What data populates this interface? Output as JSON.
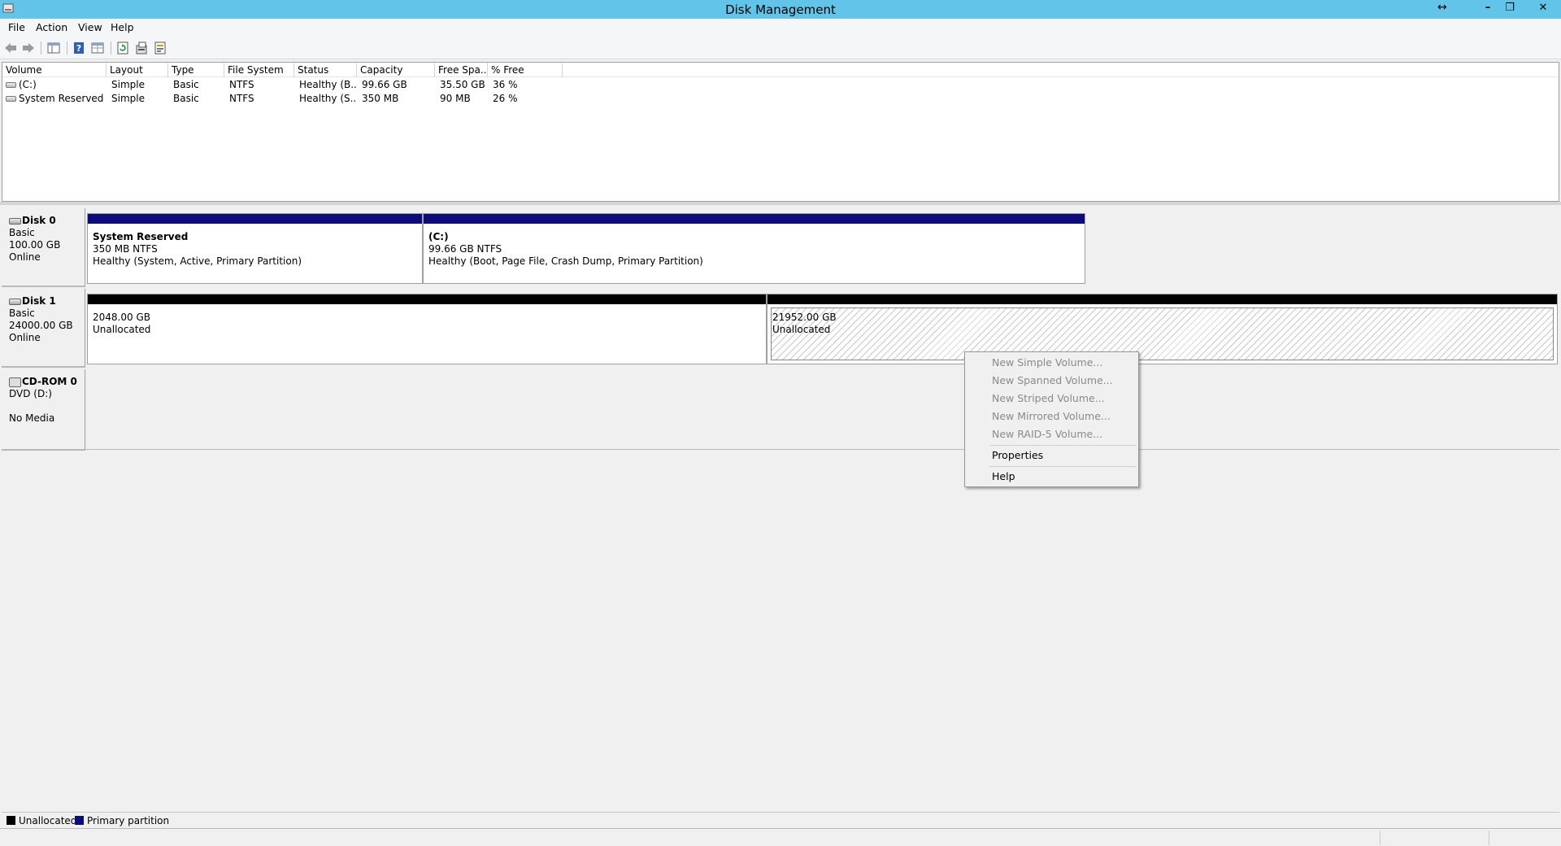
{
  "window": {
    "title": "Disk Management",
    "resize_glyph": "↔",
    "minimize": "–",
    "restore": "❐",
    "close": "✕"
  },
  "menu": [
    "File",
    "Action",
    "View",
    "Help"
  ],
  "toolbar": {
    "icons": [
      "back-arrow-icon",
      "forward-arrow-icon",
      "console-tree-icon",
      "help-icon",
      "view-icon",
      "refresh-icon",
      "properties-icon",
      "rescan-disks-icon"
    ]
  },
  "volume_list": {
    "columns": [
      "Volume",
      "Layout",
      "Type",
      "File System",
      "Status",
      "Capacity",
      "Free Spa...",
      "% Free"
    ],
    "rows": [
      [
        "(C:)",
        "Simple",
        "Basic",
        "NTFS",
        "Healthy (B...",
        "99.66 GB",
        "35.50 GB",
        "36 %"
      ],
      [
        "System Reserved",
        "Simple",
        "Basic",
        "NTFS",
        "Healthy (S...",
        "350 MB",
        "90 MB",
        "26 %"
      ]
    ]
  },
  "disks": [
    {
      "name": "Disk 0",
      "kind": "Basic",
      "size": "100.00 GB",
      "state": "Online",
      "partitions": [
        {
          "title": "System Reserved",
          "line1": "350 MB NTFS",
          "line2": "Healthy (System, Active, Primary Partition)"
        },
        {
          "title": "(C:)",
          "line1": "99.66 GB NTFS",
          "line2": "Healthy (Boot, Page File, Crash Dump, Primary Partition)"
        }
      ]
    },
    {
      "name": "Disk 1",
      "kind": "Basic",
      "size": "24000.00 GB",
      "state": "Online",
      "partitions": [
        {
          "line1": "2048.00 GB",
          "line2": "Unallocated"
        },
        {
          "line1": "21952.00 GB",
          "line2": "Unallocated"
        }
      ]
    }
  ],
  "cdrom": {
    "name": "CD-ROM 0",
    "drive": "DVD (D:)",
    "media": "No Media"
  },
  "context_menu": {
    "items": [
      "New Simple Volume...",
      "New Spanned Volume...",
      "New Striped Volume...",
      "New Mirrored Volume...",
      "New RAID-5 Volume...",
      "Properties",
      "Help"
    ]
  },
  "legend": {
    "items": [
      "Unallocated",
      "Primary partition"
    ],
    "colors": [
      "#000000",
      "#0b0b7a"
    ]
  }
}
